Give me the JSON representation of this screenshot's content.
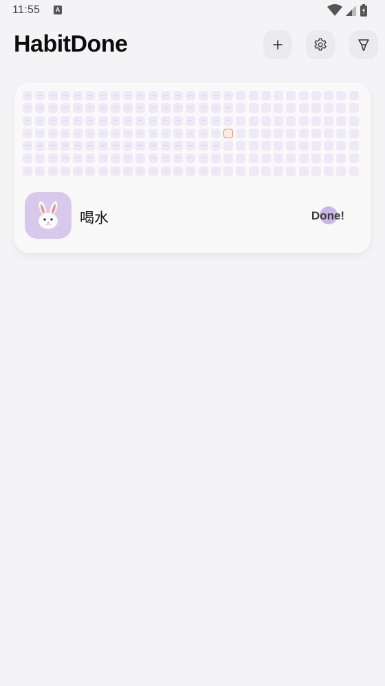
{
  "status_bar": {
    "time": "11:55",
    "notification_icon": "a-icon"
  },
  "header": {
    "title": "HabitDone",
    "actions": [
      {
        "name": "add-button",
        "icon": "plus-icon"
      },
      {
        "name": "settings-button",
        "icon": "gear-icon"
      },
      {
        "name": "filter-button",
        "icon": "filter-icon"
      }
    ]
  },
  "habits": [
    {
      "name": "喝水",
      "icon": "rabbit-icon",
      "action_label": "Done!",
      "heatmap": {
        "rows": 7,
        "columns": 27,
        "days_elapsed": 116,
        "completed_days": 0
      }
    }
  ],
  "colors": {
    "background": "#f4f4f7",
    "card": "#f9f9f9",
    "cell": "#efe9f7",
    "accent": "#cbb6e8",
    "icon_bg": "#d8c9ec",
    "today_outline": "#e08a6c"
  }
}
